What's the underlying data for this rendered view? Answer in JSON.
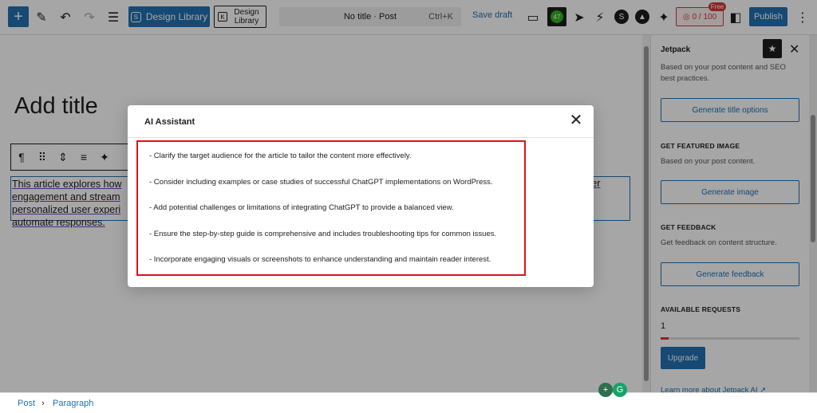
{
  "toolbar": {
    "add_block": "+",
    "design_library": "Design Library",
    "design_library_alt_line1": "Design",
    "design_library_alt_line2": "Library",
    "command_title": "No title · Post",
    "command_shortcut": "Ctrl+K",
    "save_draft": "Save draft",
    "usage": "0 / 100",
    "free_badge": "Free",
    "publish": "Publish",
    "plugin_badge": "47"
  },
  "editor": {
    "title_placeholder": "Add title",
    "paragraph_lines": [
      "This article explores how",
      "engagement and stream",
      "personalized user experi",
      "automate responses."
    ],
    "paragraph_right_lines": [
      "ser",
      "",
      "d"
    ]
  },
  "modal": {
    "title": "AI Assistant",
    "suggestions": [
      "- Clarify the target audience for the article to tailor the content more effectively.",
      "- Consider including examples or case studies of successful ChatGPT implementations on WordPress.",
      "- Add potential challenges or limitations of integrating ChatGPT to provide a balanced view.",
      "- Ensure the step-by-step guide is comprehensive and includes troubleshooting tips for common issues.",
      "- Incorporate engaging visuals or screenshots to enhance understanding and maintain reader interest."
    ]
  },
  "sidebar": {
    "title": "Jetpack",
    "intro": "Based on your post content and SEO best practices.",
    "generate_title": "Generate title options",
    "featured_cap": "GET FEATURED IMAGE",
    "featured_text": "Based on your post content.",
    "generate_image": "Generate image",
    "feedback_cap": "GET FEEDBACK",
    "feedback_text": "Get feedback on content structure.",
    "generate_feedback": "Generate feedback",
    "requests_cap": "AVAILABLE REQUESTS",
    "requests_count": "1",
    "requests_progress": 0.06,
    "upgrade": "Upgrade",
    "learn_more": "Learn more about Jetpack AI ↗"
  },
  "footer": {
    "crumb1": "Post",
    "separator": "›",
    "crumb2": "Paragraph"
  },
  "colors": {
    "accent": "#2271b1",
    "danger": "#d63638",
    "highlight_border": "#e0111a"
  }
}
